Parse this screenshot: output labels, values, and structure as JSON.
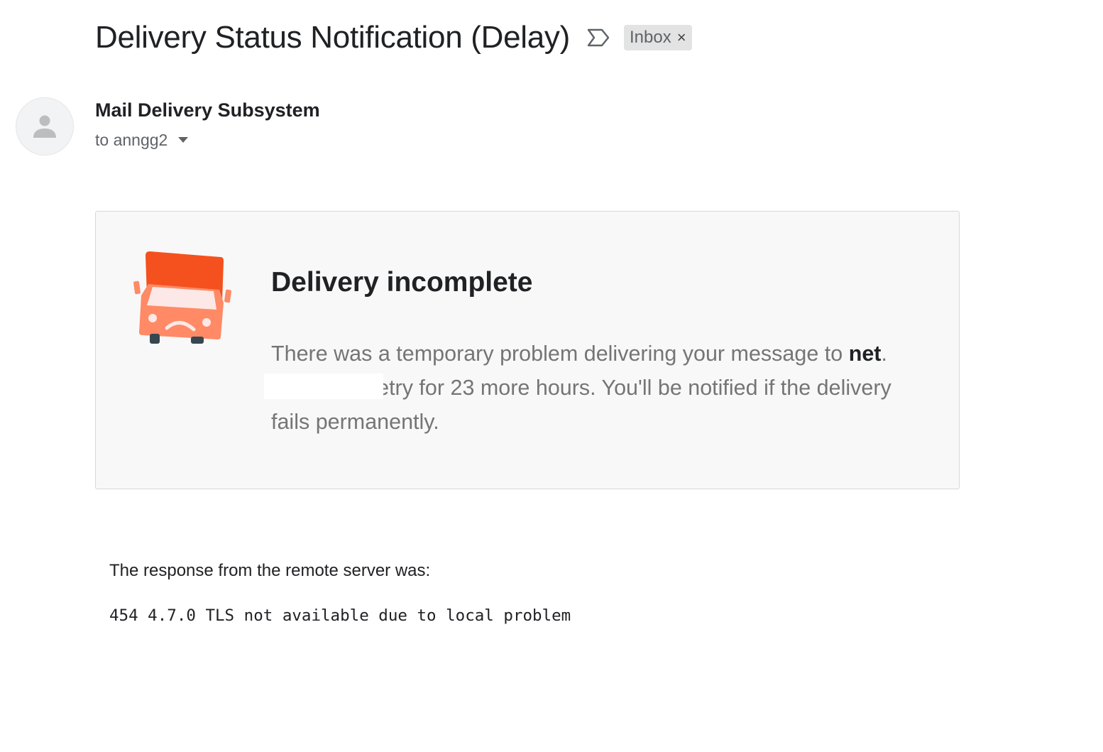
{
  "header": {
    "subject": "Delivery Status Notification (Delay)",
    "important_marker_icon": "important-marker-icon",
    "label": {
      "text": "Inbox",
      "close_symbol": "×"
    }
  },
  "sender": {
    "avatar_icon": "person-icon",
    "name": "Mail Delivery Subsystem",
    "recipient_line": "to anngg2",
    "details_icon": "caret-down-icon"
  },
  "card": {
    "illustration_icon": "sad-truck-icon",
    "title": "Delivery incomplete",
    "body_prefix": "There was a temporary problem delivering your message to ",
    "recipient_address": "net",
    "body_suffix": ". Gmail will retry for 23 more hours. You'll be notified if the delivery fails permanently.",
    "colors": {
      "truck_top": "#f4511e",
      "truck_body": "#ff8a65",
      "truck_glass": "#fce8e6",
      "wheels": "#37474f"
    }
  },
  "response": {
    "label": "The response from the remote server was:",
    "code": "454 4.7.0 TLS not available due to local problem"
  }
}
